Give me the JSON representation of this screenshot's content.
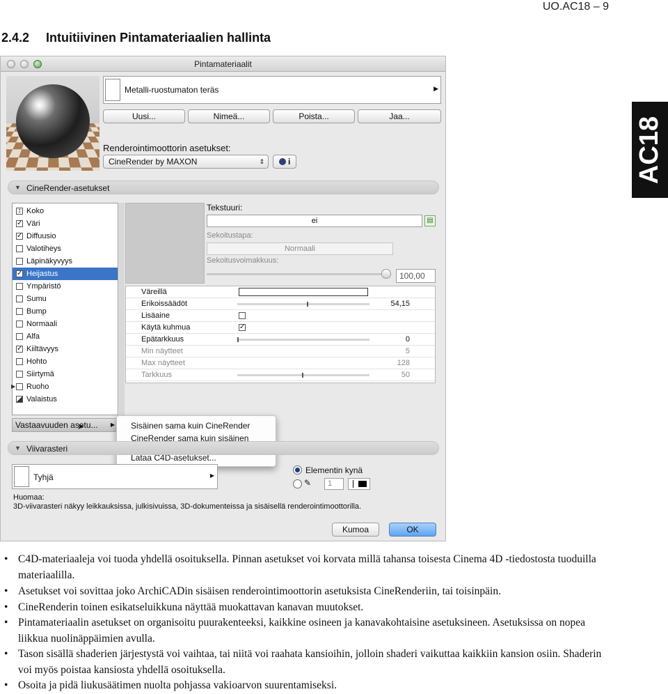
{
  "page_header": "UO.AC18 – 9",
  "section": {
    "number": "2.4.2",
    "title": "Intuitiivinen Pintamateriaalien hallinta"
  },
  "side_tab": "AC18",
  "dialog": {
    "title": "Pintamateriaalit",
    "material_name": "Metalli-ruostumaton teräs",
    "buttons": {
      "new": "Uusi...",
      "rename": "Nimeä...",
      "delete": "Poista...",
      "share": "Jaa..."
    },
    "engine_label": "Renderointimoottorin asetukset:",
    "engine_value": "CineRender by MAXON",
    "info_label": "i",
    "cinerender_section": "CineRender-asetukset",
    "channels": [
      {
        "label": "Koko",
        "checked": false,
        "special": "size"
      },
      {
        "label": "Väri",
        "checked": true
      },
      {
        "label": "Diffuusio",
        "checked": true
      },
      {
        "label": "Valotiheys",
        "checked": false
      },
      {
        "label": "Läpinäkyvyys",
        "checked": false
      },
      {
        "label": "Heijastus",
        "checked": true,
        "selected": true
      },
      {
        "label": "Ympäristö",
        "checked": false
      },
      {
        "label": "Sumu",
        "checked": false
      },
      {
        "label": "Bump",
        "checked": false
      },
      {
        "label": "Normaali",
        "checked": false
      },
      {
        "label": "Alfa",
        "checked": false
      },
      {
        "label": "Kiiltävyys",
        "checked": true
      },
      {
        "label": "Hohto",
        "checked": false
      },
      {
        "label": "Siirtymä",
        "checked": false
      },
      {
        "label": "Ruoho",
        "checked": false,
        "expandable": true
      },
      {
        "label": "Valaistus",
        "checked": false,
        "special": "light"
      }
    ],
    "texture": {
      "label": "Tekstuuri:",
      "value": "ei",
      "blend_mode_label": "Sekoitustapa:",
      "blend_mode_value": "Normaali",
      "blend_strength_label": "Sekoitusvoimakkuus:",
      "blend_strength_value": "100,00",
      "blend_strength_fraction": 1.0
    },
    "properties": [
      {
        "label": "Väreillä",
        "value": "",
        "kind": "color"
      },
      {
        "label": "Erikoissäädöt",
        "value": "54,15",
        "kind": "slider",
        "level": 0.54
      },
      {
        "label": "Lisäaine",
        "value": "",
        "kind": "check",
        "checked": false
      },
      {
        "label": "Käytä kuhmua",
        "value": "",
        "kind": "check",
        "checked": true
      },
      {
        "label": "Epätarkkuus",
        "value": "0",
        "kind": "slider",
        "level": 0.0
      },
      {
        "label": "Min näytteet",
        "value": "5",
        "kind": "text",
        "dim": true
      },
      {
        "label": "Max näytteet",
        "value": "128",
        "kind": "text",
        "dim": true
      },
      {
        "label": "Tarkkuus",
        "value": "50",
        "kind": "slider",
        "level": 0.5,
        "dim": true
      }
    ],
    "sync_button": "Vastaavuuden asetu...",
    "sync_menu": [
      "Sisäinen sama kuin CineRender",
      "CineRender sama kuin sisäinen",
      "Lataa C4D-asetukset..."
    ],
    "hatch_section": "Viivarasteri",
    "hatch_value": "Tyhjä",
    "pen_option": "Elementin kynä",
    "pen_number": "1",
    "note_title": "Huomaa:",
    "note_text": "3D-viivarasteri näkyy leikkauksissa, julkisivuissa, 3D-dokumenteissa ja sisäisellä renderointimoottorilla.",
    "cancel": "Kumoa",
    "ok": "OK"
  },
  "bullets": [
    "C4D-materiaaleja voi tuoda yhdellä osoituksella. Pinnan asetukset voi korvata millä tahansa toisesta Cinema 4D -tiedostosta tuoduilla materiaalilla.",
    "Asetukset voi sovittaa joko ArchiCADin sisäisen renderointimoottorin asetuksista CineRenderiin, tai toisinpäin.",
    "CineRenderin toinen esikatseluikkuna näyttää muokattavan kanavan muutokset.",
    "Pintamateriaalin asetukset on organisoitu puurakenteeksi, kaikkine osineen ja kanavakohtaisine asetuksineen. Asetuksissa on nopea liikkua nuolinäppäimien avulla.",
    "Tason sisällä shaderien järjestystä voi vaihtaa, tai niitä voi raahata kansioihin, jolloin shaderi vaikuttaa kaikkiin kansion osiin. Shaderin voi myös poistaa kansiosta yhdellä osoituksella.",
    "Osoita ja pidä liukusäätimen nuolta pohjassa vakioarvon suurentamiseksi."
  ]
}
